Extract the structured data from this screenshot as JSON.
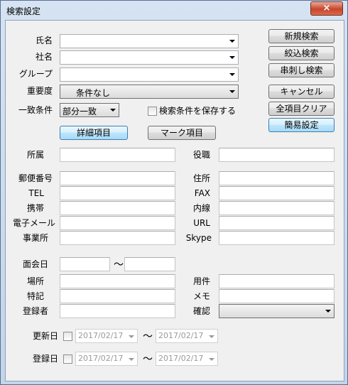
{
  "window": {
    "title": "検索設定",
    "close_icon": "×"
  },
  "labels": {
    "name": "氏名",
    "company": "社名",
    "group": "グループ",
    "importance": "重要度",
    "match": "一致条件",
    "affiliation": "所属",
    "position": "役職",
    "zip": "郵便番号",
    "address": "住所",
    "tel": "TEL",
    "fax": "FAX",
    "mobile": "携帯",
    "extension": "内線",
    "email": "電子メール",
    "url": "URL",
    "office": "事業所",
    "skype": "Skype",
    "meeting_date": "面会日",
    "range_sep": "〜",
    "place": "場所",
    "business": "用件",
    "note": "特記",
    "memo": "メモ",
    "registrant": "登録者",
    "confirm": "確認",
    "updated_date": "更新日",
    "registered_date": "登録日"
  },
  "fields": {
    "importance_value": "条件なし",
    "match_value": "部分一致",
    "updated_from": "2017/02/17",
    "updated_to": "2017/02/17",
    "registered_from": "2017/02/17",
    "registered_to": "2017/02/17"
  },
  "buttons": {
    "new_search": "新規検索",
    "narrow_search": "絞込検索",
    "skewer_search": "串刺し検索",
    "cancel": "キャンセル",
    "clear_all": "全項目クリア",
    "simple_settings": "簡易設定",
    "detail_items": "詳細項目",
    "mark_items": "マーク項目"
  },
  "save_conditions_label": "検索条件を保存する",
  "colors": {
    "title_bg": "#c8d9ee",
    "client_bg": "#f0f0f0",
    "close_red": "#c7452c",
    "blue_btn": "#bee6fd"
  }
}
